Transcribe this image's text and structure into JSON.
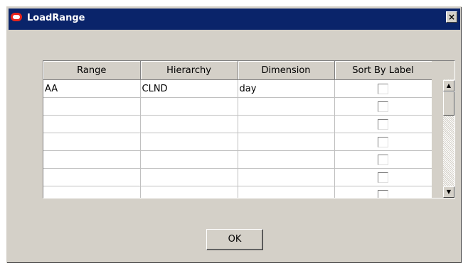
{
  "window": {
    "title": "LoadRange",
    "close_label": "×",
    "logo_icon": "oracle-logo-icon"
  },
  "grid": {
    "columns": [
      "Range",
      "Hierarchy",
      "Dimension",
      "Sort By Label"
    ],
    "rows": [
      {
        "range": "AA",
        "hierarchy": "CLND",
        "dimension": "day",
        "sort_by_label": false
      },
      {
        "range": "",
        "hierarchy": "",
        "dimension": "",
        "sort_by_label": false
      },
      {
        "range": "",
        "hierarchy": "",
        "dimension": "",
        "sort_by_label": false
      },
      {
        "range": "",
        "hierarchy": "",
        "dimension": "",
        "sort_by_label": false
      },
      {
        "range": "",
        "hierarchy": "",
        "dimension": "",
        "sort_by_label": false
      },
      {
        "range": "",
        "hierarchy": "",
        "dimension": "",
        "sort_by_label": false
      },
      {
        "range": "",
        "hierarchy": "",
        "dimension": "",
        "sort_by_label": false
      }
    ]
  },
  "scrollbar": {
    "up_icon": "scroll-up-arrow-icon",
    "down_icon": "scroll-down-arrow-icon"
  },
  "buttons": {
    "ok_label": "OK"
  },
  "colors": {
    "titlebar": "#0a246a",
    "dialog_bg": "#d4d0c8",
    "oracle_red": "#e8251b"
  }
}
